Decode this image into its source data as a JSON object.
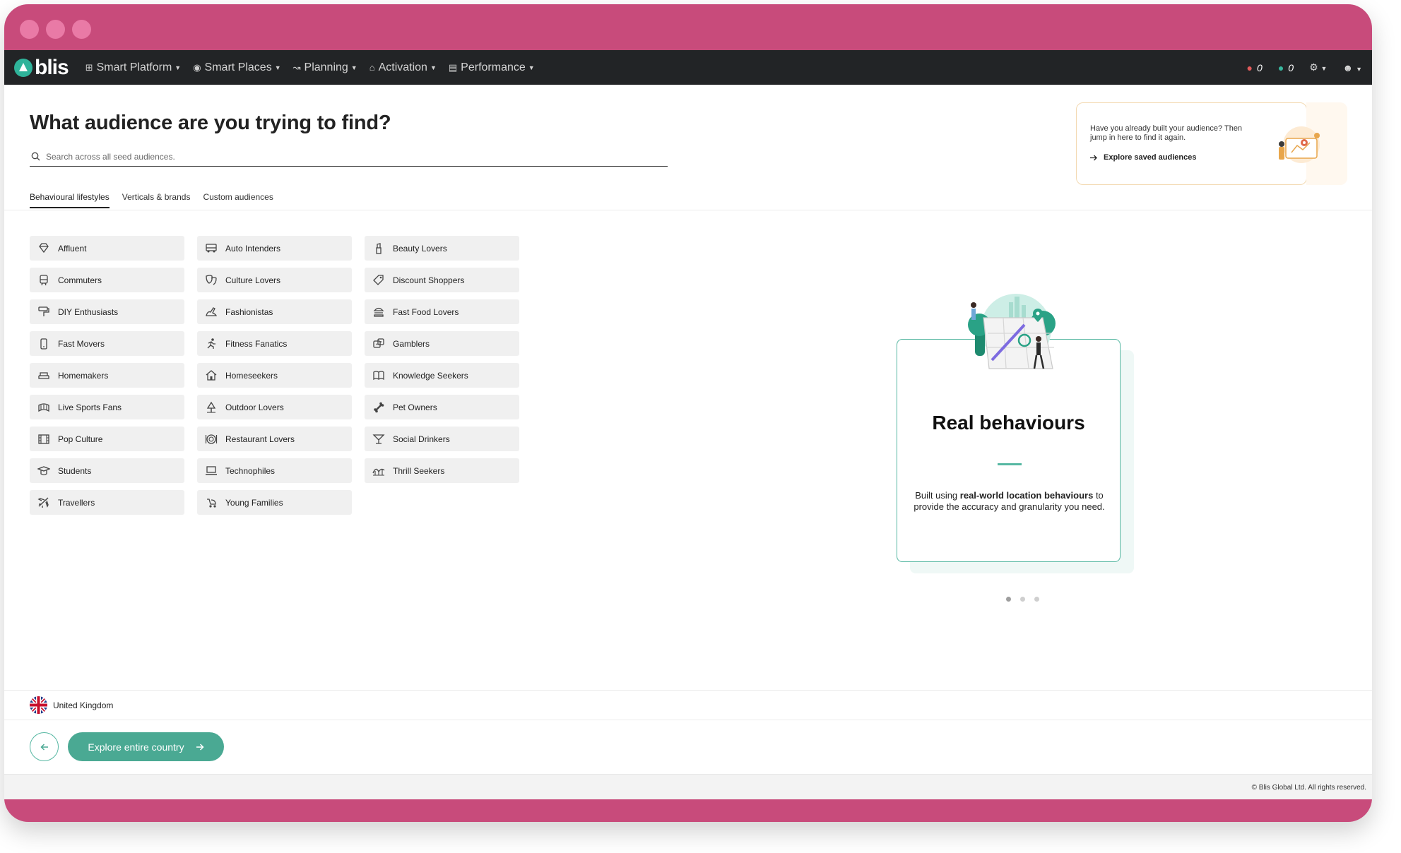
{
  "window": {
    "traffic_lights": [
      "close",
      "minimize",
      "maximize"
    ]
  },
  "nav": {
    "logo_text": "blis",
    "items": [
      {
        "label": "Smart Platform",
        "icon": "grid-icon"
      },
      {
        "label": "Smart Places",
        "icon": "compass-icon"
      },
      {
        "label": "Planning",
        "icon": "line-chart-icon"
      },
      {
        "label": "Activation",
        "icon": "home-icon"
      },
      {
        "label": "Performance",
        "icon": "bar-chart-icon"
      }
    ],
    "counters": [
      {
        "icon": "drop-red-icon",
        "value": "0",
        "color": "#e15a5a"
      },
      {
        "icon": "drop-teal-icon",
        "value": "0",
        "color": "#38b79e"
      }
    ]
  },
  "page": {
    "title": "What audience are you trying to find?",
    "search_placeholder": "Search across all seed audiences.",
    "tabs": [
      "Behavioural lifestyles",
      "Verticals & brands",
      "Custom audiences"
    ],
    "active_tab": "Behavioural lifestyles"
  },
  "saved_card": {
    "question": "Have you already built your audience? Then jump in here to find it again.",
    "link": "Explore saved audiences"
  },
  "audiences": [
    {
      "label": "Affluent",
      "icon": "diamond-icon"
    },
    {
      "label": "Auto Intenders",
      "icon": "car-icon"
    },
    {
      "label": "Beauty Lovers",
      "icon": "lipstick-icon"
    },
    {
      "label": "Commuters",
      "icon": "train-icon"
    },
    {
      "label": "Culture Lovers",
      "icon": "theatre-masks-icon"
    },
    {
      "label": "Discount Shoppers",
      "icon": "tag-icon"
    },
    {
      "label": "DIY Enthusiasts",
      "icon": "paint-roller-icon"
    },
    {
      "label": "Fashionistas",
      "icon": "shoe-icon"
    },
    {
      "label": "Fast Food Lovers",
      "icon": "burger-icon"
    },
    {
      "label": "Fast Movers",
      "icon": "phone-icon"
    },
    {
      "label": "Fitness Fanatics",
      "icon": "runner-icon"
    },
    {
      "label": "Gamblers",
      "icon": "dice-icon"
    },
    {
      "label": "Homemakers",
      "icon": "sofa-icon"
    },
    {
      "label": "Homeseekers",
      "icon": "house-icon"
    },
    {
      "label": "Knowledge Seekers",
      "icon": "book-icon"
    },
    {
      "label": "Live Sports Fans",
      "icon": "stadium-icon"
    },
    {
      "label": "Outdoor Lovers",
      "icon": "tree-icon"
    },
    {
      "label": "Pet Owners",
      "icon": "bone-icon"
    },
    {
      "label": "Pop Culture",
      "icon": "film-icon"
    },
    {
      "label": "Restaurant Lovers",
      "icon": "plate-icon"
    },
    {
      "label": "Social Drinkers",
      "icon": "cocktail-icon"
    },
    {
      "label": "Students",
      "icon": "graduation-icon"
    },
    {
      "label": "Technophiles",
      "icon": "laptop-icon"
    },
    {
      "label": "Thrill Seekers",
      "icon": "rollercoaster-icon"
    },
    {
      "label": "Travellers",
      "icon": "plane-icon"
    },
    {
      "label": "Young Families",
      "icon": "stroller-icon"
    }
  ],
  "promo": {
    "title": "Real behaviours",
    "text_pre": "Built using ",
    "text_bold": "real-world location behaviours",
    "text_post": " to provide the accuracy and granularity you need.",
    "slides": 3,
    "active_slide": 0,
    "accent": "#56b7a2"
  },
  "country": {
    "name": "United Kingdom",
    "flag": "uk-flag-icon"
  },
  "actions": {
    "explore_label": "Explore entire country"
  },
  "footer": {
    "copyright": "© Blis Global Ltd. All rights reserved."
  },
  "colors": {
    "frame": "#c84b7b",
    "navbar": "#222426",
    "accent": "#4aa993"
  }
}
